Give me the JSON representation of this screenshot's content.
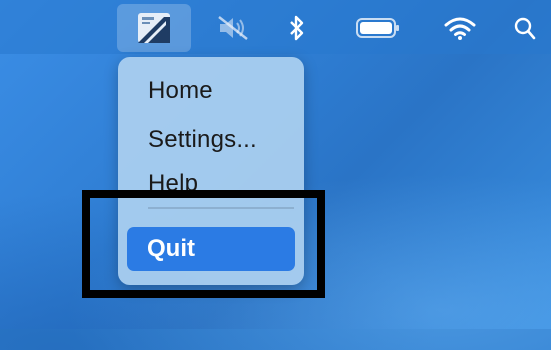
{
  "menubar": {
    "icons": [
      "app-icon",
      "mute-icon",
      "bluetooth-icon",
      "battery-icon",
      "wifi-icon",
      "search-icon"
    ]
  },
  "menu": {
    "items": [
      {
        "label": "Home"
      },
      {
        "label": "Settings..."
      },
      {
        "label": "Help"
      }
    ],
    "quit_label": "Quit"
  },
  "colors": {
    "desktop": "#2f7fd0",
    "menu_background": "#add0f0",
    "selected_item": "#2b7be4",
    "annotation_border": "#000000"
  }
}
